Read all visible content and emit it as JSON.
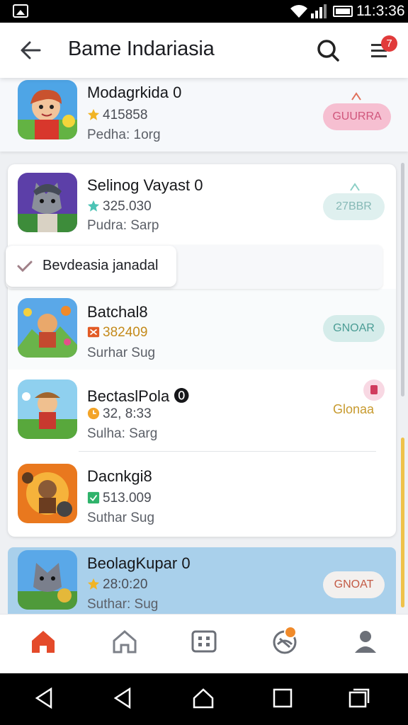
{
  "status_bar": {
    "time": "11:3:36"
  },
  "header": {
    "title": "Bame Indariasia",
    "notification_count": "7"
  },
  "featured": {
    "name": "Modagrkida 0",
    "rating": "415858",
    "subtitle": "Pedha: 1org",
    "button_label": "GUURRA"
  },
  "list": [
    {
      "name": "Selinog Vayast 0",
      "rating": "325.030",
      "subtitle": "Pudra: Sarp",
      "button_label": "27BBR"
    },
    {
      "name": "Batchal8",
      "rating": "382409",
      "subtitle": "Surhar Sug",
      "button_label": "GNOAR"
    },
    {
      "name": "BectaslPola ⓿",
      "rating": "32, 8:33",
      "subtitle": "Sulha: Sarg",
      "button_label": "Glonaa"
    },
    {
      "name": "Dacnkgi8",
      "rating": "513.009",
      "subtitle": "Suthar Sug",
      "button_label": ""
    }
  ],
  "tooltip": {
    "label": "Bevdeasia janadal"
  },
  "last_item": {
    "name": "BeolagKupar 0",
    "rating": "28:0:20",
    "subtitle": "Suthar: Sug",
    "button_label": "GNOAT"
  },
  "colors": {
    "accent_pink": "#f6bfd1",
    "accent_mint": "#d5ecea",
    "gold": "#efc24b",
    "home_red": "#e44a2a",
    "highlight_blue": "#a9d0eb"
  }
}
